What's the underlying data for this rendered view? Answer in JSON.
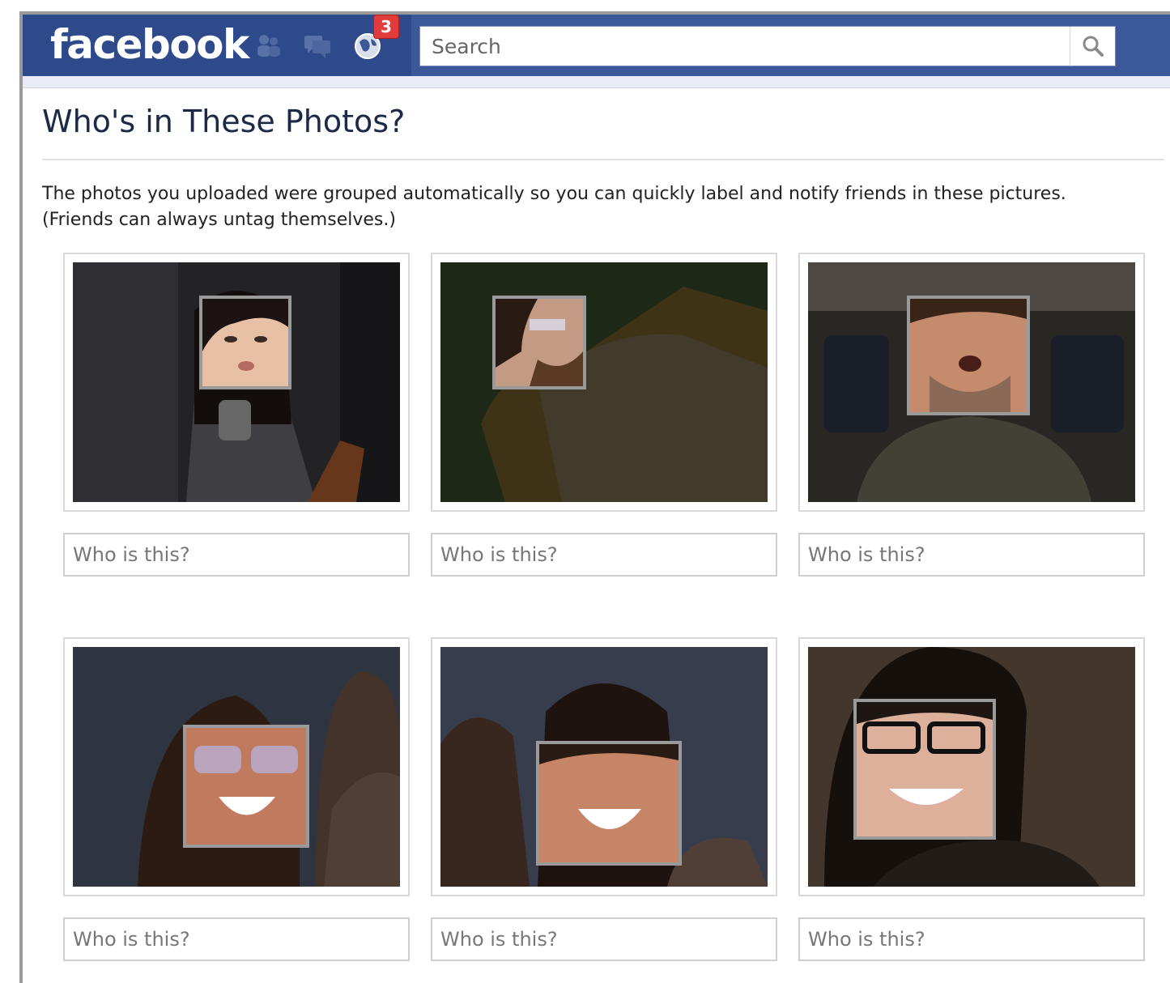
{
  "header": {
    "logo_text": "facebook",
    "jewels": [
      {
        "name": "friend-requests-icon"
      },
      {
        "name": "messages-icon"
      },
      {
        "name": "notifications-icon",
        "badge": "3"
      }
    ],
    "search": {
      "placeholder": "Search",
      "value": ""
    }
  },
  "main": {
    "title": "Who's in These Photos?",
    "description_line1": "The photos you uploaded were grouped automatically so you can quickly label and notify friends in these pictures.",
    "description_line2": "(Friends can always untag themselves.)",
    "photos": [
      {
        "placeholder": "Who is this?"
      },
      {
        "placeholder": "Who is this?"
      },
      {
        "placeholder": "Who is this?"
      },
      {
        "placeholder": "Who is this?"
      },
      {
        "placeholder": "Who is this?"
      },
      {
        "placeholder": "Who is this?"
      }
    ]
  },
  "colors": {
    "brand_blue": "#3b5998",
    "brand_dark": "#2e4a8b",
    "badge_red": "#e23b3b"
  }
}
